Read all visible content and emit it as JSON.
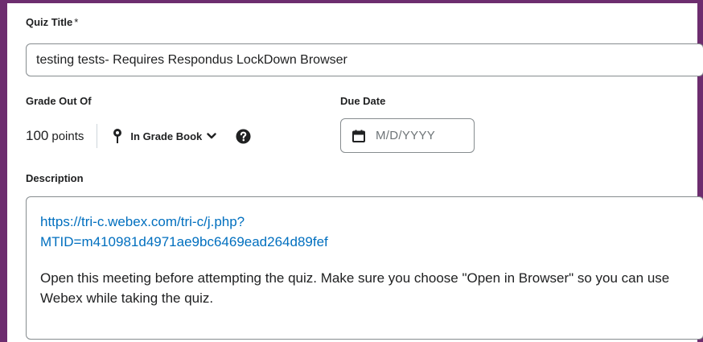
{
  "quiz_title": {
    "label": "Quiz Title",
    "required_marker": "*",
    "value": "testing tests- Requires Respondus LockDown Browser"
  },
  "grade": {
    "label": "Grade Out Of",
    "value": "100",
    "unit": "points",
    "gradebook_label": "In Grade Book",
    "pin_icon": "pin-icon",
    "chevron_icon": "chevron-down-icon",
    "help_icon": "help-icon"
  },
  "due_date": {
    "label": "Due Date",
    "placeholder": "M/D/YYYY",
    "icon": "calendar-icon"
  },
  "description": {
    "label": "Description",
    "link_line1": "https://tri-c.webex.com/tri-c/j.php?",
    "link_line2": "MTID=m410981d4971ae9bc6469ead264d89fef",
    "text": "Open this meeting before attempting the quiz. Make sure you choose \"Open in Browser\" so you can use Webex while taking the quiz."
  },
  "colors": {
    "frame_accent": "#6d2d6f",
    "link": "#006fbf",
    "text": "#202122",
    "border": "#868c8f"
  }
}
